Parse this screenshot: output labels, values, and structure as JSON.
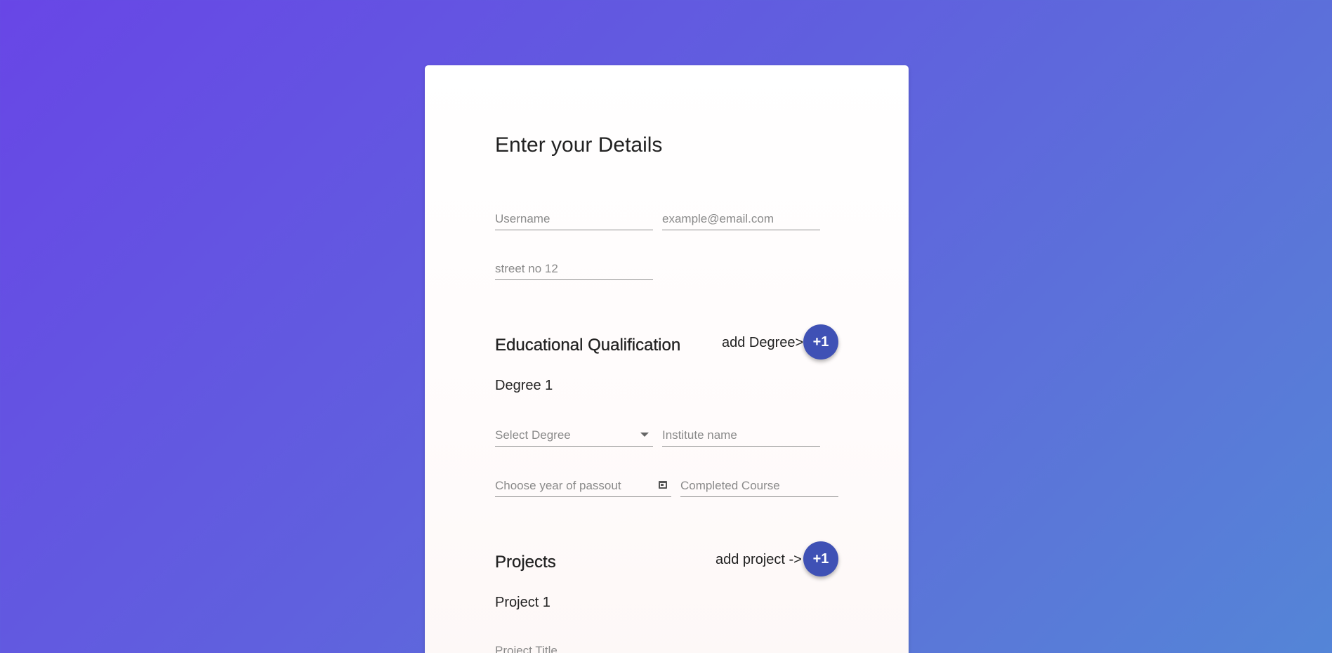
{
  "form": {
    "title": "Enter your Details",
    "username_placeholder": "Username",
    "email_placeholder": "example@email.com",
    "address_placeholder": "street no 12"
  },
  "education": {
    "title": "Educational Qualification",
    "add_label": "add Degree>",
    "add_button": "+1",
    "degree_heading": "Degree 1",
    "degree_select_placeholder": "Select Degree",
    "institute_placeholder": "Institute name",
    "year_placeholder": "Choose year of passout",
    "course_placeholder": "Completed Course"
  },
  "projects": {
    "title": "Projects",
    "add_label": "add project ->",
    "add_button": "+1",
    "project_heading": "Project 1",
    "title_placeholder": "Project Title"
  },
  "icons": {
    "degree_dropdown": "chevron-down-icon",
    "year_picker": "calendar-icon"
  },
  "colors": {
    "accent": "#3f51b5",
    "background_start": "#6846e6",
    "background_end": "#5485d7"
  }
}
